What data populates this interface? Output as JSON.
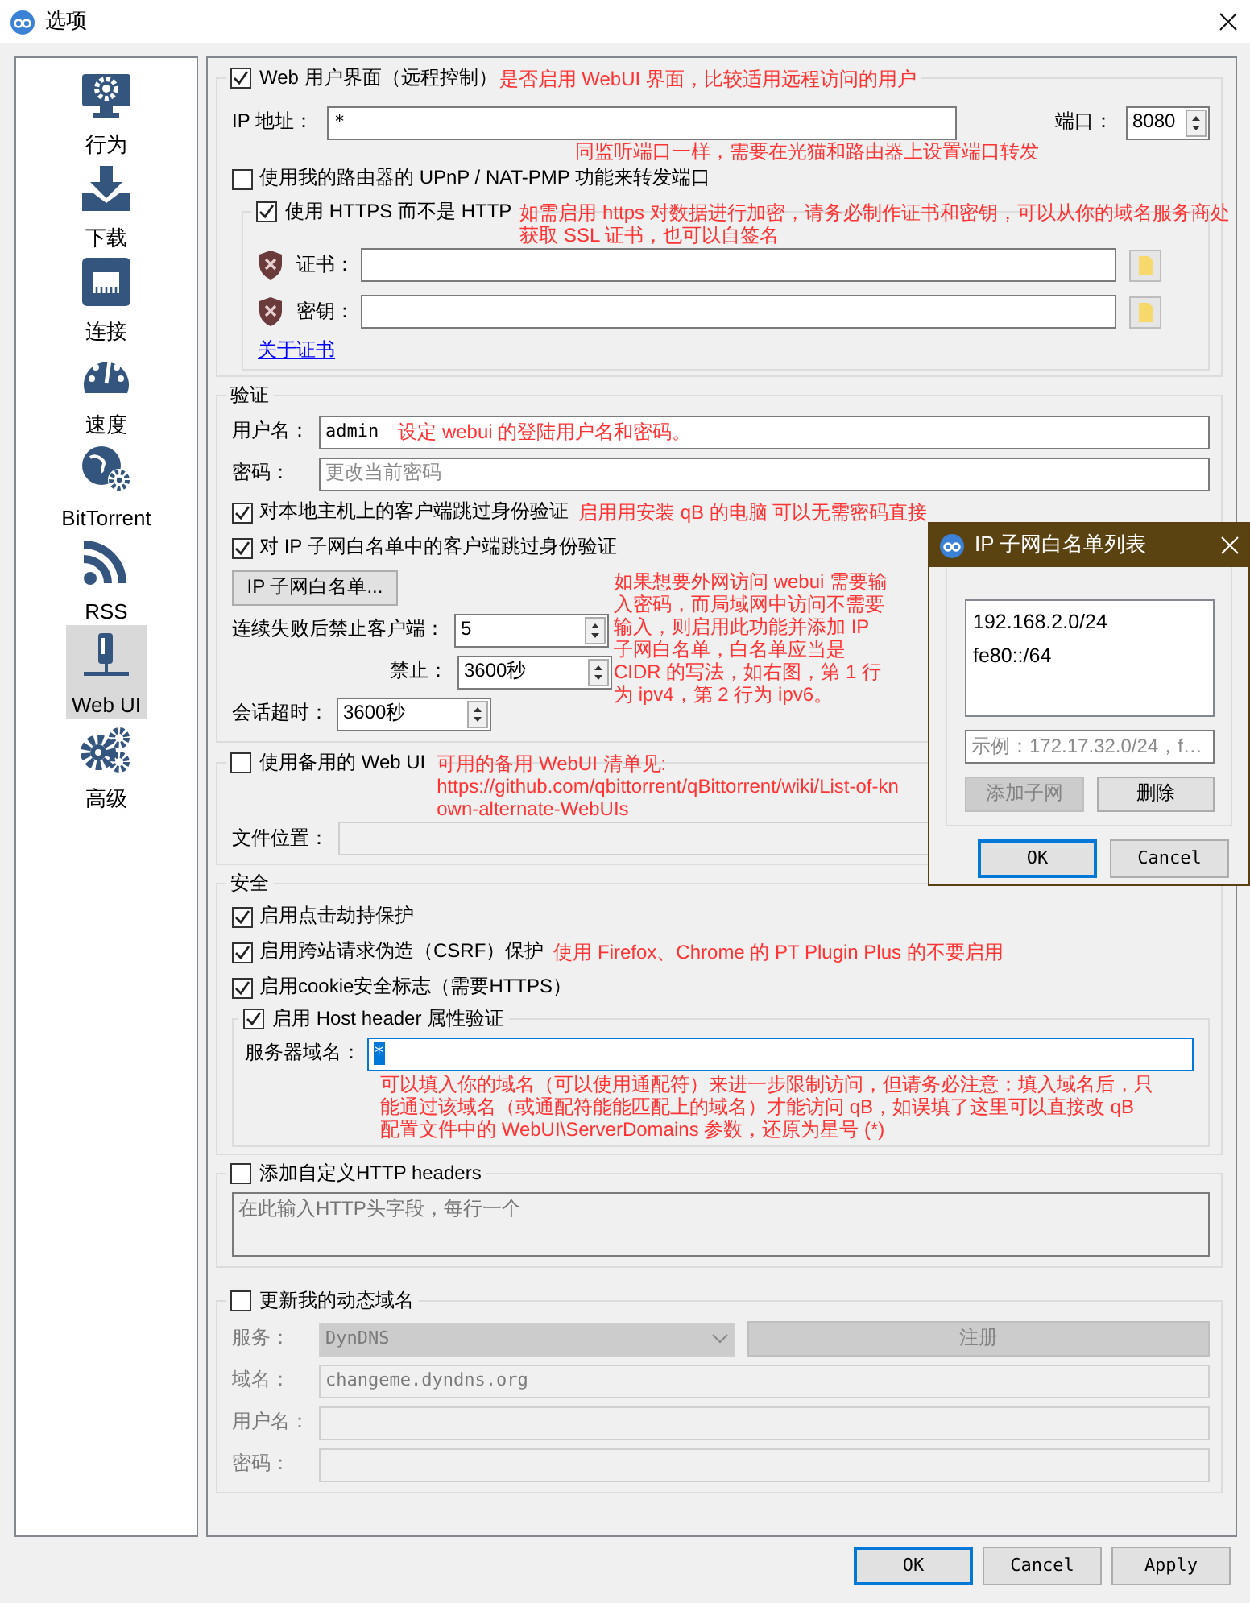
{
  "window": {
    "title": "选项"
  },
  "sidebar": {
    "items": [
      {
        "kind": "behavior",
        "label": "行为",
        "selected": false
      },
      {
        "kind": "downloads",
        "label": "下载",
        "selected": false
      },
      {
        "kind": "connection",
        "label": "连接",
        "selected": false
      },
      {
        "kind": "speed",
        "label": "速度",
        "selected": false
      },
      {
        "kind": "bittorrent",
        "label": "BitTorrent",
        "selected": false
      },
      {
        "kind": "rss",
        "label": "RSS",
        "selected": false
      },
      {
        "kind": "webui",
        "label": "Web UI",
        "selected": true
      },
      {
        "kind": "advanced",
        "label": "高级",
        "selected": false
      }
    ]
  },
  "webui": {
    "label": "Web 用户界面（远程控制）",
    "checked": true,
    "note": "是否启用 WebUI 界面，比较适用远程访问的用户",
    "ip_label": "IP 地址：",
    "ip": "*",
    "ip_note": "同监听端口一样，需要在光猫和路由器上设置端口转发",
    "port_label": "端口：",
    "port": "8080",
    "upnp": {
      "label": "使用我的路由器的 UPnP / NAT-PMP 功能来转发端口",
      "checked": false
    },
    "https": {
      "label": "使用 HTTPS 而不是 HTTP",
      "checked": true,
      "note": "如需启用 https 对数据进行加密，请务必制作证书和密钥，可以从你的域名服务商处获取 SSL 证书，也可以自签名",
      "files": [
        {
          "label": "证书："
        },
        {
          "label": "密钥："
        }
      ],
      "link": "关于证书"
    }
  },
  "auth": {
    "title": "验证",
    "username_label": "用户名：",
    "username": "admin",
    "username_note": "设定 webui 的登陆用户名和密码。",
    "password_label": "密码：",
    "password_placeholder": "更改当前密码",
    "bypass": [
      {
        "label": "对本地主机上的客户端跳过身份验证",
        "checked": true,
        "note": "启用用安装 qB 的电脑 可以无需密码直接"
      },
      {
        "label": "对 IP 子网白名单中的客户端跳过身份验证",
        "checked": true
      }
    ],
    "whitelist_button": "IP 子网白名单...",
    "whitelist_note": "如果想要外网访问 webui 需要输入密码，而局域网中访问不需要输入，则启用此功能并添加 IP 子网白名单，白名单应当是 CIDR 的写法，如右图，第 1 行为 ipv4，第 2 行为 ipv6。",
    "ban_after_label": "连续失败后禁止客户端：",
    "ban_after": "5",
    "ban_label": "禁止：",
    "ban": "3600秒",
    "session_label": "会话超时：",
    "session": "3600秒"
  },
  "alt_webui": {
    "label": "使用备用的 Web UI",
    "checked": false,
    "note": "可用的备用 WebUI 清单见:\nhttps://github.com/qbittorrent/qBittorrent/wiki/List-of-known-alternate-WebUIs",
    "file_label": "文件位置："
  },
  "security": {
    "title": "安全",
    "options": [
      {
        "label": "启用点击劫持保护",
        "checked": true
      },
      {
        "label": "启用跨站请求伪造（CSRF）保护",
        "checked": true,
        "note": "使用 Firefox、Chrome 的 PT Plugin Plus 的不要启用"
      },
      {
        "label": "启用cookie安全标志（需要HTTPS）",
        "checked": true
      }
    ],
    "host_header": {
      "label": "启用 Host header 属性验证",
      "checked": true,
      "domains_label": "服务器域名：",
      "domains": "*",
      "selected": true,
      "note": "可以填入你的域名（可以使用通配符）来进一步限制访问，但请务必注意：填入域名后，只能通过该域名（或通配符能能匹配上的域名）才能访问 qB，如误填了这里可以直接改 qB 配置文件中的 WebUI\\ServerDomains 参数，还原为星号 (*)"
    }
  },
  "custom_headers": {
    "label": "添加自定义HTTP headers",
    "checked": false,
    "placeholder": "在此输入HTTP头字段，每行一个"
  },
  "ddns": {
    "label": "更新我的动态域名",
    "checked": false,
    "service_label": "服务：",
    "service": "DynDNS",
    "register": "注册",
    "domain_label": "域名：",
    "domain": "changeme.dyndns.org",
    "user_label": "用户名：",
    "password_label": "密码："
  },
  "buttons": [
    "OK",
    "Cancel",
    "Apply"
  ],
  "dialog": {
    "title": "IP 子网白名单列表",
    "entries": [
      "192.168.2.0/24",
      "fe80::/64"
    ],
    "placeholder": "示例：172.17.32.0/24，f…",
    "add": {
      "label": "添加子网",
      "disabled": true
    },
    "remove": {
      "label": "删除",
      "disabled": false
    },
    "buttons": [
      "OK",
      "Cancel"
    ]
  }
}
